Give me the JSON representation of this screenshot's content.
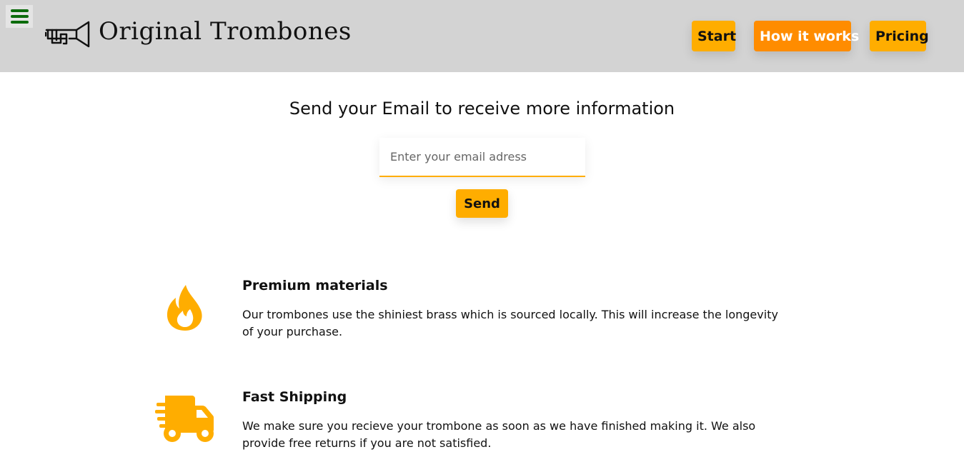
{
  "header": {
    "brand": "Original Trombones",
    "menu_icon": "hamburger-icon",
    "logo_icon": "trombone-icon",
    "nav": {
      "start": "Start",
      "how_it_works": "How it works",
      "pricing": "Pricing"
    }
  },
  "form": {
    "title": "Send your Email to receive more information",
    "email_placeholder": "Enter your email adress",
    "email_value": "",
    "send_label": "Send"
  },
  "features": [
    {
      "icon": "fire-icon",
      "title": "Premium materials",
      "text": "Our trombones use the shiniest brass which is sourced locally. This will increase the longevity of your purchase."
    },
    {
      "icon": "shipping-truck-icon",
      "title": "Fast Shipping",
      "text": "We make sure you recieve your trombone as soon as we have finished making it. We also provide free returns if you are not satisfied."
    }
  ],
  "colors": {
    "accent": "#ffad00",
    "accent_active": "#ff8c00",
    "header_bg": "#d3d3d3",
    "menu_icon": "#0b6b0b"
  }
}
